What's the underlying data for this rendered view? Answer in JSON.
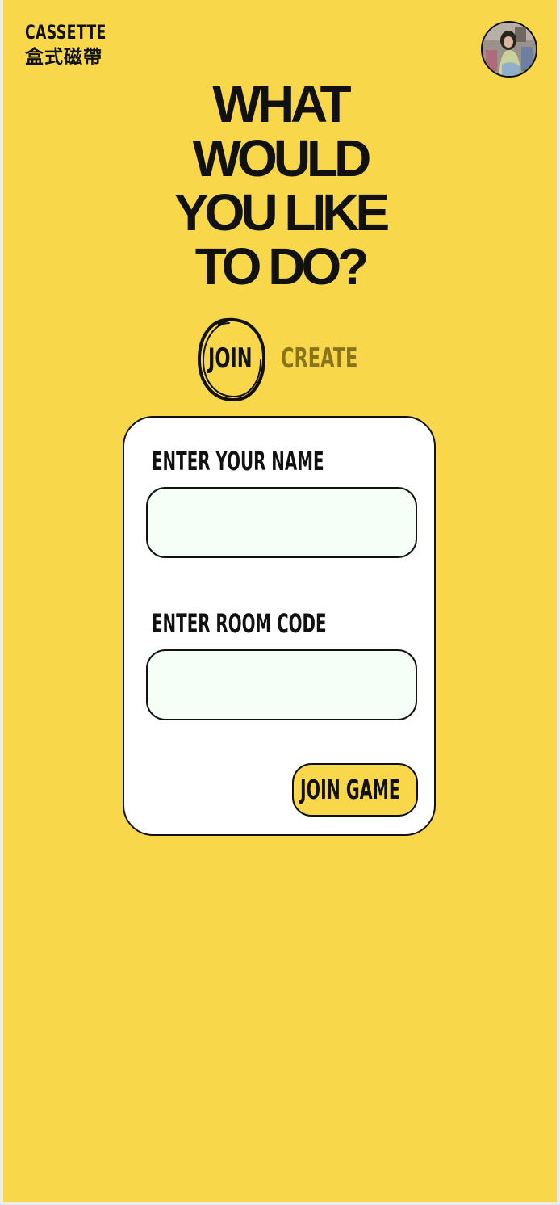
{
  "brand": {
    "name_en": "CASSETTE",
    "name_zh": "盒式磁帶"
  },
  "headline": {
    "lines": [
      "WHAT",
      "WOULD",
      "YOU LIKE",
      "TO DO?"
    ]
  },
  "mode_tabs": {
    "join_label": "JOIN",
    "create_label": "CREATE",
    "active": "JOIN"
  },
  "form": {
    "name_label": "ENTER YOUR NAME",
    "name_value": "",
    "room_label": "ENTER ROOM CODE",
    "room_value": "",
    "submit_label": "JOIN GAME"
  },
  "colors": {
    "background": "#f8d74a",
    "card": "#ffffff",
    "input_fill": "#f5fff7",
    "inactive_tab": "#8a7418",
    "ink": "#111111"
  }
}
